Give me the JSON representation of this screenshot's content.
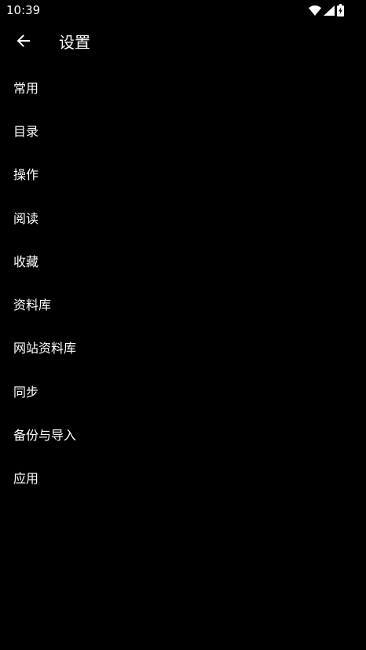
{
  "status_bar": {
    "time": "10:39",
    "icons": [
      "wifi-icon",
      "signal-icon",
      "battery-charging-icon"
    ]
  },
  "app_bar": {
    "back_icon": "arrow-left-icon",
    "title": "设置"
  },
  "settings": {
    "items": [
      {
        "label": "常用"
      },
      {
        "label": "目录"
      },
      {
        "label": "操作"
      },
      {
        "label": "阅读"
      },
      {
        "label": "收藏"
      },
      {
        "label": "资料库"
      },
      {
        "label": "网站资料库"
      },
      {
        "label": "同步"
      },
      {
        "label": "备份与导入"
      },
      {
        "label": "应用"
      }
    ]
  },
  "colors": {
    "background": "#000000",
    "text": "#ffffff"
  }
}
